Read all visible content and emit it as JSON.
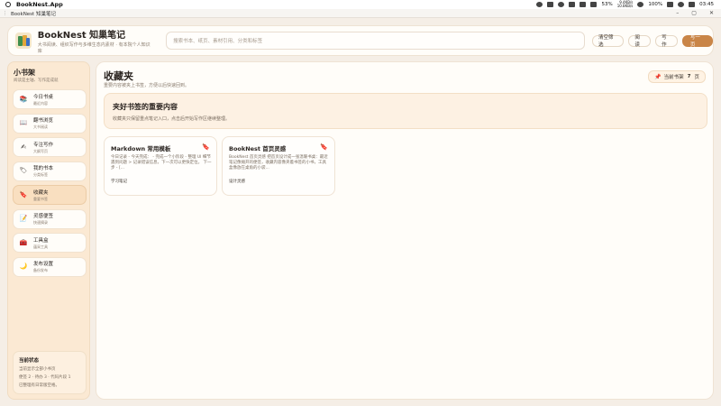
{
  "menubar": {
    "app_name": "BookNest.App",
    "battery": "53%",
    "net_up": "9.4KB/s",
    "net_down": "10.8KB/s",
    "volume": "100%",
    "clock": "03:45"
  },
  "window": {
    "title": "BookNest 知巢笔记"
  },
  "header": {
    "brand_name": "BookNest 知巢笔记",
    "tagline": "大书阅读、组织写作与多维生态内素材 · 有本院个人知识库",
    "search_placeholder": "搜索书本、纸页、素材引用、分类和标签",
    "actions": [
      "清空筛选",
      "阅读",
      "写作"
    ],
    "primary_action": "写一页"
  },
  "sidebar": {
    "title": "小书架",
    "subtitle": "阅读是主轴、写作是成就",
    "items": [
      {
        "label": "今日书桌",
        "sub": "最近内容",
        "icon": "books-icon",
        "glyph": "📚"
      },
      {
        "label": "翻书浏览",
        "sub": "大书阅读",
        "icon": "open-book-icon",
        "glyph": "📖"
      },
      {
        "label": "专注写作",
        "sub": "大纲写页",
        "icon": "pen-icon",
        "glyph": "✍"
      },
      {
        "label": "我的书本",
        "sub": "分类标签",
        "icon": "tag-icon",
        "glyph": "🏷"
      },
      {
        "label": "收藏夹",
        "sub": "重要书签",
        "icon": "bookmark-icon",
        "glyph": "🔖"
      },
      {
        "label": "灵感便签",
        "sub": "快速摘录",
        "icon": "memo-icon",
        "glyph": "📝"
      },
      {
        "label": "工具盒",
        "sub": "蕴采工具",
        "icon": "toolbox-icon",
        "glyph": "🧰"
      },
      {
        "label": "发布设置",
        "sub": "备份发布",
        "icon": "moon-icon",
        "glyph": "🌙"
      }
    ],
    "active_index": 4,
    "status": {
      "title": "当前状态",
      "lines": [
        "当前显示全部小书页",
        "便签 2 · 待办 3 · 代码片段 1",
        "已整理有日常版空格。"
      ]
    }
  },
  "main": {
    "title": "收藏夹",
    "subtitle": "重要内容被夹上书签，方便以后快速回到。",
    "badge_prefix": "当前书架",
    "badge_count": "7",
    "badge_suffix": "页",
    "hero": {
      "title": "夹好书签的重要内容",
      "desc": "收藏夹只保留重点笔记入口，点击后开始写作区继续整理。"
    },
    "cards": [
      {
        "title": "Markdown 常用模板",
        "body": "今日记录 - 今天完成： - 完成一个小阶段 - 整理 UI 细节  遇到问题 > 记录错误信息，下一次可以更快定位。  下一步 - [...",
        "tag": "学习笔记"
      },
      {
        "title": "BookNest 首页灵感",
        "body": "BookNest 首页灵感  把首页设计成一张温暖书桌：最近笔记像摊开的便签，收藏内容像夹着书签的小书，工具盒像放在桌角的小袋...",
        "tag": "设计灵感"
      }
    ]
  }
}
